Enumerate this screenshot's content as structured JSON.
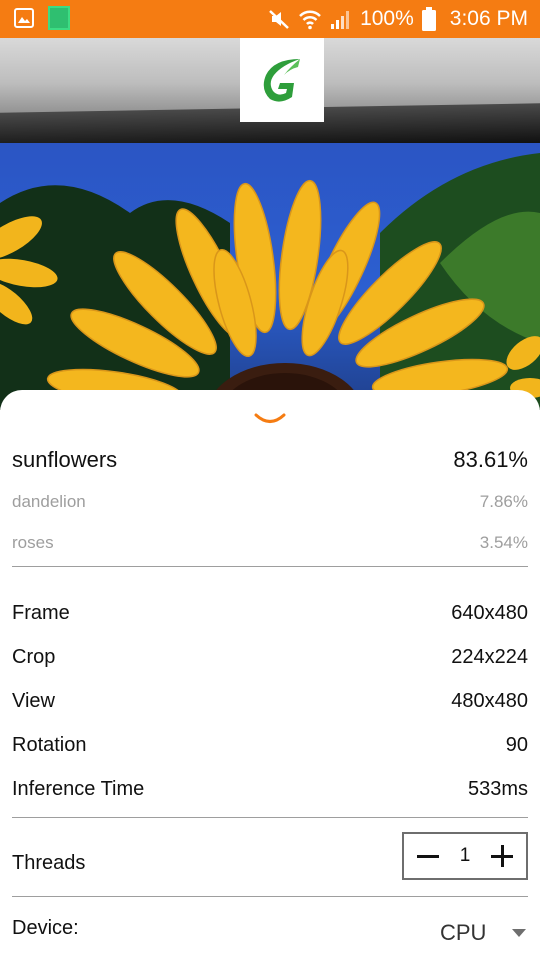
{
  "status_bar": {
    "battery": "100%",
    "time": "3:06 PM",
    "color": "#f57c12"
  },
  "logo": {
    "icon": "leaf-g-logo-icon"
  },
  "results": {
    "top": {
      "label": "sunflowers",
      "value": "83.61%"
    },
    "others": [
      {
        "label": "dandelion",
        "value": "7.86%"
      },
      {
        "label": "roses",
        "value": "3.54%"
      }
    ]
  },
  "info": [
    {
      "label": "Frame",
      "value": "640x480"
    },
    {
      "label": "Crop",
      "value": "224x224"
    },
    {
      "label": "View",
      "value": "480x480"
    },
    {
      "label": "Rotation",
      "value": "90"
    },
    {
      "label": "Inference Time",
      "value": "533ms"
    }
  ],
  "threads": {
    "label": "Threads",
    "value": "1"
  },
  "device": {
    "label": "Device:",
    "value": "CPU"
  },
  "colors": {
    "accent": "#f57c12"
  }
}
